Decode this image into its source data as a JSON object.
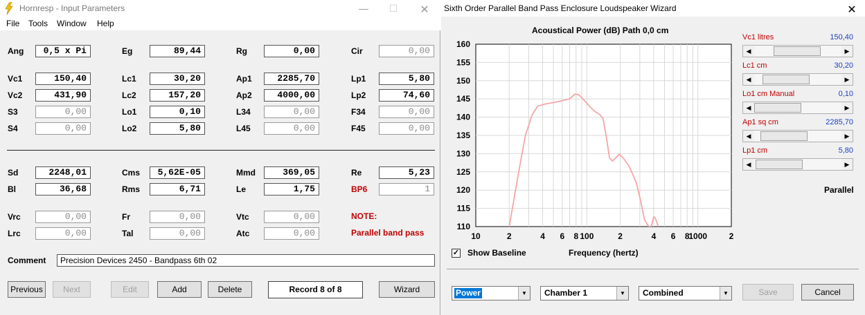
{
  "left_window": {
    "title": "Hornresp - Input Parameters",
    "menu": [
      "File",
      "Tools",
      "Window",
      "Help"
    ],
    "params": [
      {
        "label": "Ang",
        "value": "0,5 x Pi",
        "style": "str"
      },
      {
        "label": "Eg",
        "value": "89,44",
        "style": "str"
      },
      {
        "label": "Rg",
        "value": "0,00",
        "style": "str"
      },
      {
        "label": "Cir",
        "value": "0,00",
        "style": "dim"
      },
      {
        "label": "Vc1",
        "value": "150,40",
        "style": "str"
      },
      {
        "label": "Lc1",
        "value": "30,20",
        "style": "str"
      },
      {
        "label": "Ap1",
        "value": "2285,70",
        "style": "str"
      },
      {
        "label": "Lp1",
        "value": "5,80",
        "style": "str"
      },
      {
        "label": "Vc2",
        "value": "431,90",
        "style": "str"
      },
      {
        "label": "Lc2",
        "value": "157,20",
        "style": "str"
      },
      {
        "label": "Ap2",
        "value": "4000,00",
        "style": "str"
      },
      {
        "label": "Lp2",
        "value": "74,60",
        "style": "str"
      },
      {
        "label": "S3",
        "value": "0,00",
        "style": "dim"
      },
      {
        "label": "Lo1",
        "value": "0,10",
        "style": "str"
      },
      {
        "label": "L34",
        "value": "0,00",
        "style": "dim"
      },
      {
        "label": "F34",
        "value": "0,00",
        "style": "dim"
      },
      {
        "label": "S4",
        "value": "0,00",
        "style": "dim"
      },
      {
        "label": "Lo2",
        "value": "5,80",
        "style": "str"
      },
      {
        "label": "L45",
        "value": "0,00",
        "style": "dim"
      },
      {
        "label": "F45",
        "value": "0,00",
        "style": "dim"
      },
      {
        "label": "Sd",
        "value": "2248,01",
        "style": "str"
      },
      {
        "label": "Cms",
        "value": "5,62E-05",
        "style": "str"
      },
      {
        "label": "Mmd",
        "value": "369,05",
        "style": "str"
      },
      {
        "label": "Re",
        "value": "5,23",
        "style": "str"
      },
      {
        "label": "Bl",
        "value": "36,68",
        "style": "str"
      },
      {
        "label": "Rms",
        "value": "6,71",
        "style": "str"
      },
      {
        "label": "Le",
        "value": "1,75",
        "style": "str"
      },
      {
        "label": "BP6",
        "value": "1",
        "style": "dim",
        "label_red": true
      },
      {
        "label": "Vrc",
        "value": "0,00",
        "style": "dim"
      },
      {
        "label": "Fr",
        "value": "0,00",
        "style": "dim"
      },
      {
        "label": "Vtc",
        "value": "0,00",
        "style": "dim"
      },
      {
        "label": "Lrc",
        "value": "0,00",
        "style": "dim"
      },
      {
        "label": "Tal",
        "value": "0,00",
        "style": "dim"
      },
      {
        "label": "Atc",
        "value": "0,00",
        "style": "dim"
      }
    ],
    "note_label": "NOTE:",
    "note_text": "Parallel band pass",
    "comment_label": "Comment",
    "comment_value": "Precision Devices 2450 - Bandpass 6th 02",
    "buttons": {
      "previous": "Previous",
      "next": "Next",
      "edit": "Edit",
      "add": "Add",
      "delete": "Delete",
      "wizard": "Wizard"
    },
    "record": "Record 8 of 8"
  },
  "right_window": {
    "title": "Sixth Order Parallel Band Pass Enclosure Loudspeaker Wizard",
    "chart_header": "Acoustical Power (dB)   Path 0,0 cm",
    "sliders": [
      {
        "label": "Vc1  litres",
        "value": "150,40",
        "position": 0.48
      },
      {
        "label": "Lc1  cm",
        "value": "30,20",
        "position": 0.2
      },
      {
        "label": "Lo1  cm  Manual",
        "value": "0,10",
        "position": 0.0
      },
      {
        "label": "Ap1  sq cm",
        "value": "2285,70",
        "position": 0.16
      },
      {
        "label": "Lp1  cm",
        "value": "5,80",
        "position": 0.03
      }
    ],
    "parallel_label": "Parallel",
    "show_baseline_label": "Show Baseline",
    "show_baseline_checked": true,
    "checkbox_mark": "✓",
    "freq_axis_label": "Frequency (hertz)",
    "dropdowns": [
      "Power",
      "Chamber 1",
      "Combined"
    ],
    "buttons": {
      "save": "Save",
      "cancel": "Cancel"
    }
  },
  "colors": {
    "curve": "#f4a6a6",
    "label_red": "#c00000",
    "value_blue": "#1a3fc0",
    "selection": "#0078d7"
  },
  "chart_data": {
    "type": "line",
    "title": "Acoustical Power (dB)   Path 0,0 cm",
    "xlabel": "Frequency (hertz)",
    "ylabel": "",
    "x_scale": "log",
    "xlim": [
      10,
      2000
    ],
    "ylim": [
      110,
      160
    ],
    "y_ticks": [
      160,
      155,
      150,
      145,
      140,
      135,
      130,
      125,
      120,
      115,
      110
    ],
    "x_tick_labels": [
      {
        "x": 10,
        "label": "10"
      },
      {
        "x": 20,
        "label": "2"
      },
      {
        "x": 40,
        "label": "4"
      },
      {
        "x": 60,
        "label": "6"
      },
      {
        "x": 80,
        "label": "8"
      },
      {
        "x": 100,
        "label": "100"
      },
      {
        "x": 200,
        "label": "2"
      },
      {
        "x": 400,
        "label": "4"
      },
      {
        "x": 600,
        "label": "6"
      },
      {
        "x": 800,
        "label": "8"
      },
      {
        "x": 1000,
        "label": "1000"
      },
      {
        "x": 2000,
        "label": "2"
      }
    ],
    "grid": true,
    "series": [
      {
        "x": [
          20,
          24,
          28,
          32,
          36,
          42,
          50,
          60,
          70,
          78,
          84,
          90,
          100,
          110,
          120,
          130,
          140,
          150,
          160,
          170,
          180,
          195,
          210,
          225,
          240,
          260,
          280,
          300,
          330,
          360,
          380,
          400,
          410,
          420,
          440
        ],
        "y": [
          110,
          124,
          135,
          140.5,
          143,
          143.6,
          144,
          144.5,
          145,
          146.3,
          146.2,
          145.4,
          143.8,
          142.4,
          141.4,
          140.8,
          139.6,
          134.5,
          128.8,
          128,
          128.7,
          129.8,
          129,
          127.8,
          126.6,
          124.2,
          121.8,
          118,
          112,
          110,
          110,
          112.6,
          112.4,
          111.8,
          110
        ]
      }
    ]
  }
}
